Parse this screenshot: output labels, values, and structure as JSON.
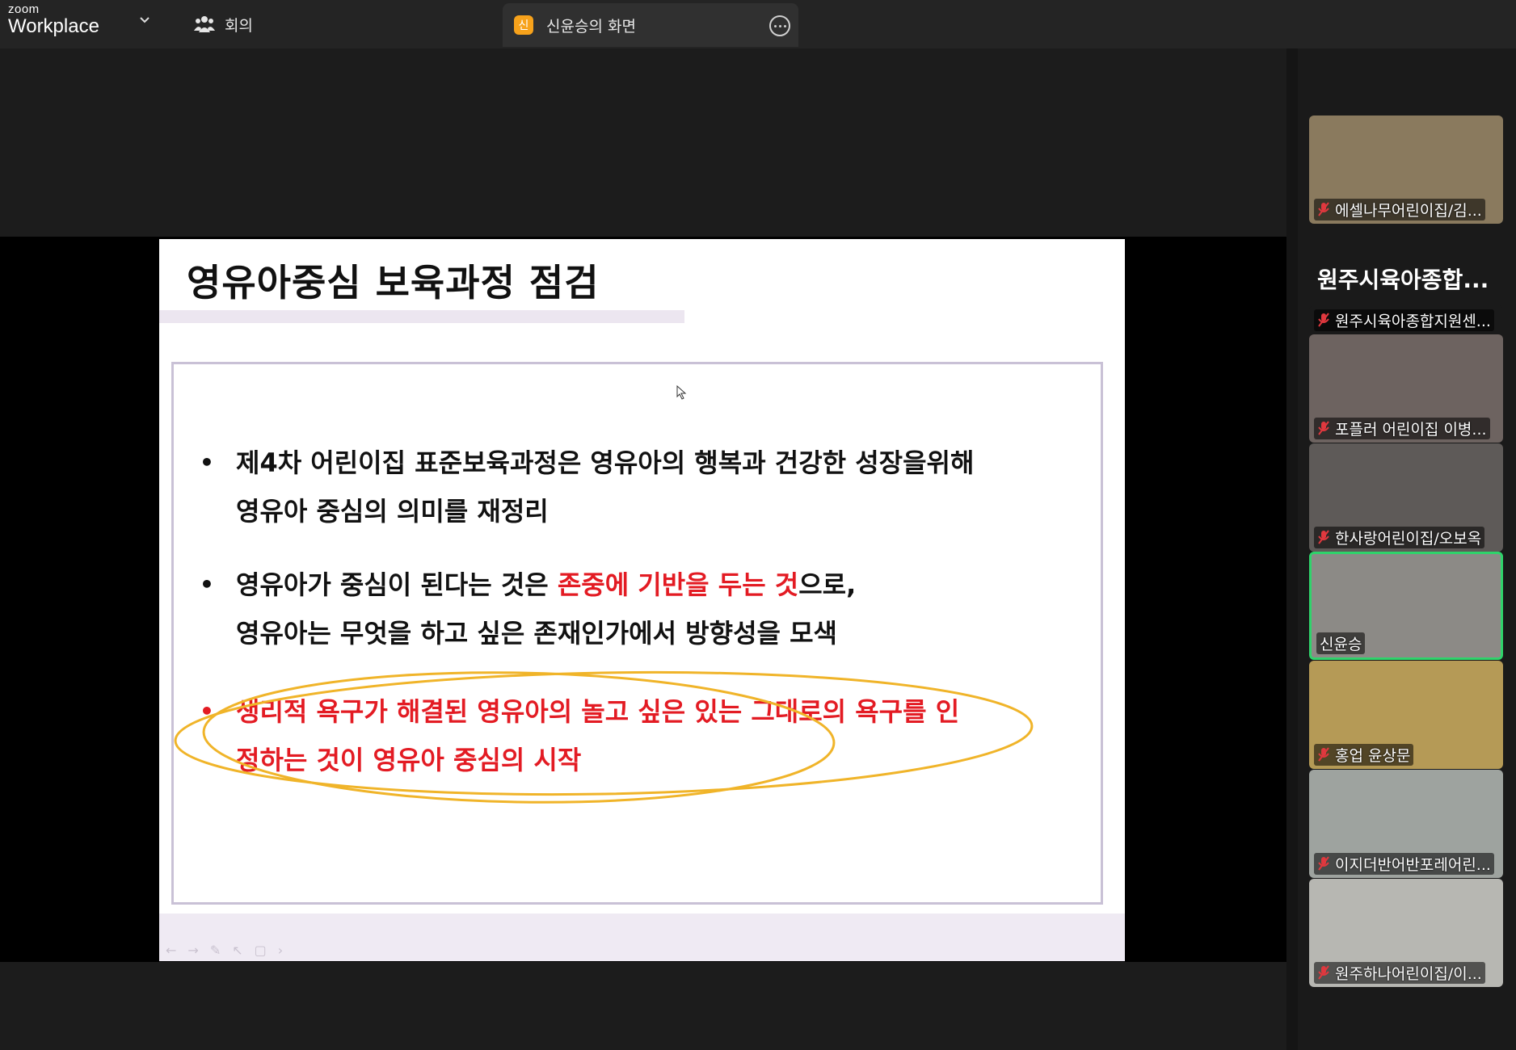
{
  "app": {
    "logo_small": "zoom",
    "logo_big": "Workplace"
  },
  "tabs": {
    "meeting_label": "회의",
    "share_avatar_letter": "신",
    "share_title": "신윤승의 화면"
  },
  "slide": {
    "title": "영유아중심 보육과정 점검",
    "bullets": [
      {
        "line1": "제4차 어린이집 표준보육과정은 영유아의 행복과 건강한 성장을위해",
        "line2": "영유아 중심의 의미를 재정리"
      },
      {
        "line1_pre": "영유아가 중심이 된다는 것은 ",
        "line1_red": "존중에 기반을 두는 것",
        "line1_post": "으로,",
        "line2": "영유아는 무엇을 하고 싶은 존재인가에서 방향성을 모색"
      },
      {
        "line1": "생리적 욕구가 해결된 영유아의 놀고 싶은 있는 그대로의 욕구를 인",
        "line2": "정하는 것이 영유아 중심의 시작"
      }
    ],
    "bullet_symbol": "•",
    "footer_controls": [
      "←",
      "→",
      "✎",
      "↖",
      "▢",
      "›"
    ]
  },
  "participants": {
    "group_label": "원주시육아종합...",
    "tiles": [
      {
        "name": "에셀나무어린이집/김...",
        "muted": true,
        "bg": "#8a7a5e",
        "active": false
      },
      {
        "name": "원주시육아종합지원센...",
        "muted": true,
        "bg": "#1a1a1a",
        "active": false
      },
      {
        "name": "포플러 어린이집 이병...",
        "muted": true,
        "bg": "#6d6360",
        "active": false
      },
      {
        "name": "한사랑어린이집/오보옥",
        "muted": true,
        "bg": "#5e5a58",
        "active": false
      },
      {
        "name": "신윤승",
        "muted": false,
        "bg": "#8c8a86",
        "active": true
      },
      {
        "name": "홍업 윤상문",
        "muted": true,
        "bg": "#b59a56",
        "active": false
      },
      {
        "name": "이지더반어반포레어린...",
        "muted": true,
        "bg": "#9ea39f",
        "active": false
      },
      {
        "name": "원주하나어린이집/이...",
        "muted": true,
        "bg": "#b7b7b2",
        "active": false
      }
    ]
  },
  "colors": {
    "accent_active": "#2fd36b",
    "highlight_red": "#e31b23",
    "annotation_yellow": "#f0b429",
    "share_avatar": "#f7a21b"
  }
}
